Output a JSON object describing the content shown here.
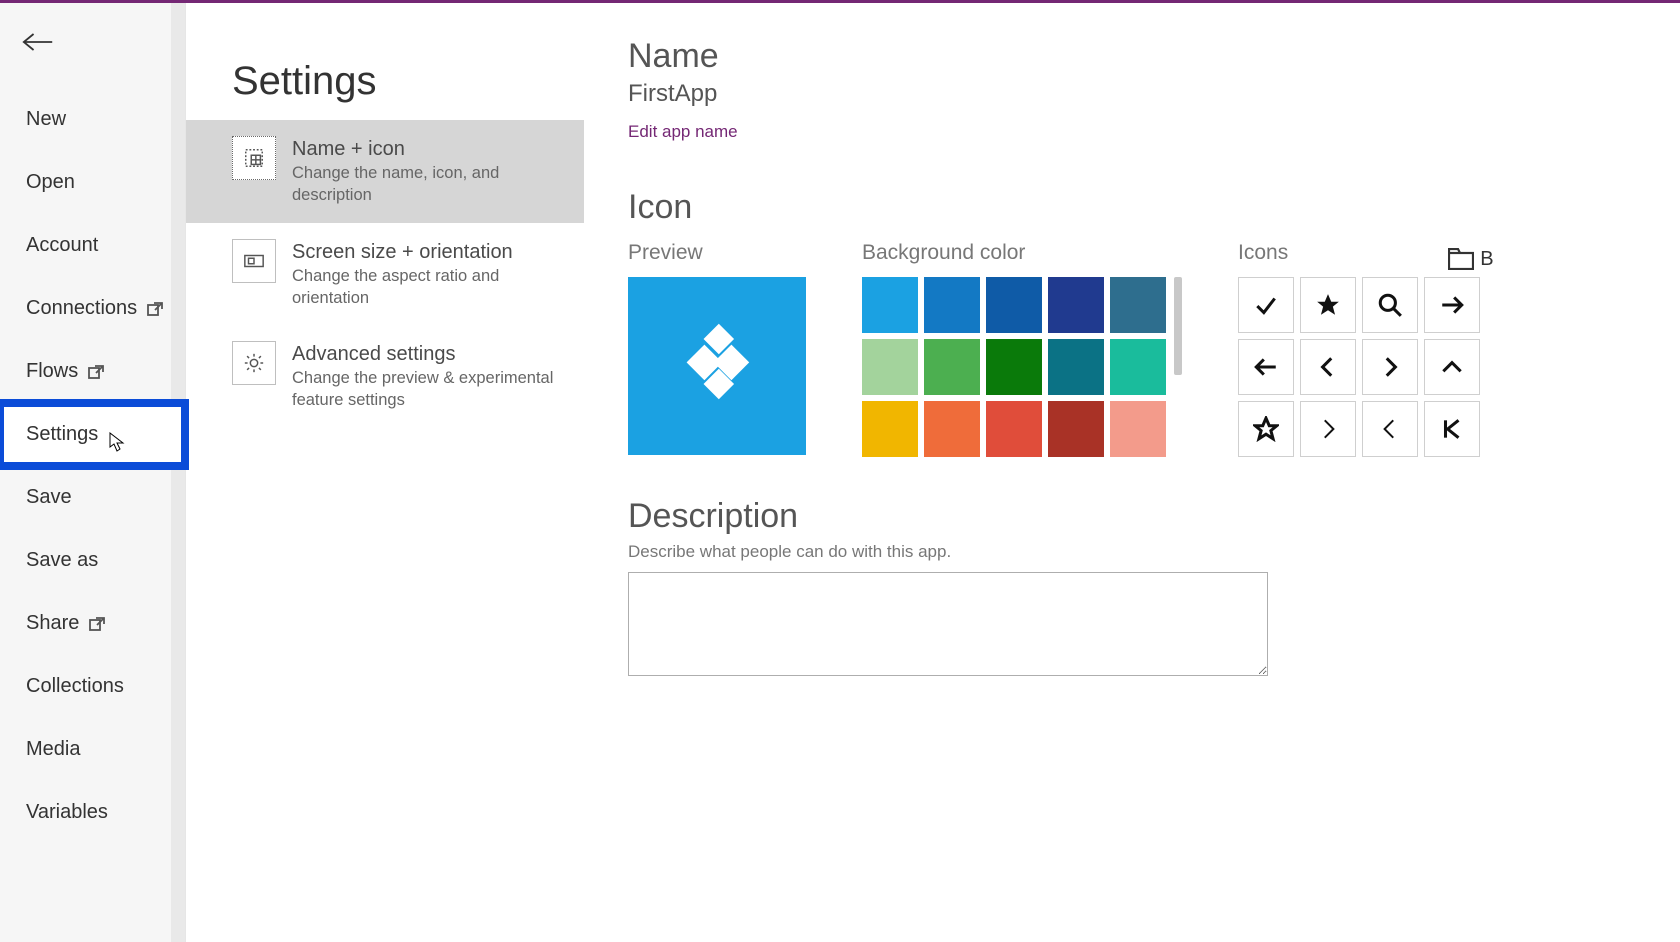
{
  "page_title": "Settings",
  "sidebar": {
    "items": [
      {
        "label": "New",
        "ext": false
      },
      {
        "label": "Open",
        "ext": false
      },
      {
        "label": "Account",
        "ext": false
      },
      {
        "label": "Connections",
        "ext": true
      },
      {
        "label": "Flows",
        "ext": true
      },
      {
        "label": "Settings",
        "ext": false,
        "highlight": true
      },
      {
        "label": "Save",
        "ext": false
      },
      {
        "label": "Save as",
        "ext": false
      },
      {
        "label": "Share",
        "ext": true
      },
      {
        "label": "Collections",
        "ext": false
      },
      {
        "label": "Media",
        "ext": false
      },
      {
        "label": "Variables",
        "ext": false
      }
    ]
  },
  "settings_tabs": [
    {
      "title": "Name + icon",
      "desc": "Change the name, icon, and description",
      "active": true,
      "icon": "name-icon"
    },
    {
      "title": "Screen size + orientation",
      "desc": "Change the aspect ratio and orientation",
      "active": false,
      "icon": "screen-icon"
    },
    {
      "title": "Advanced settings",
      "desc": "Change the preview & experimental feature settings",
      "active": false,
      "icon": "gear-icon"
    }
  ],
  "name_section": {
    "heading": "Name",
    "value": "FirstApp",
    "edit_link": "Edit app name"
  },
  "icon_section": {
    "heading": "Icon",
    "preview_label": "Preview",
    "bg_label": "Background color",
    "icons_label": "Icons",
    "browse_label": "B",
    "colors": [
      "#1ba1e2",
      "#1379c4",
      "#0f5ba7",
      "#203a8f",
      "#2e6e8e",
      "#a3d39c",
      "#4caf50",
      "#0a7a0a",
      "#0b7285",
      "#1abc9c",
      "#f1b600",
      "#ef6c3a",
      "#e04d3a",
      "#a93226",
      "#f39b8b"
    ],
    "icons": [
      "check",
      "star-filled",
      "search",
      "arrow-right",
      "arrow-left",
      "chevron-left",
      "chevron-right",
      "chevron-up",
      "star-outline",
      "angle-right",
      "angle-left",
      "skip-back"
    ]
  },
  "desc_section": {
    "heading": "Description",
    "hint": "Describe what people can do with this app.",
    "value": ""
  }
}
